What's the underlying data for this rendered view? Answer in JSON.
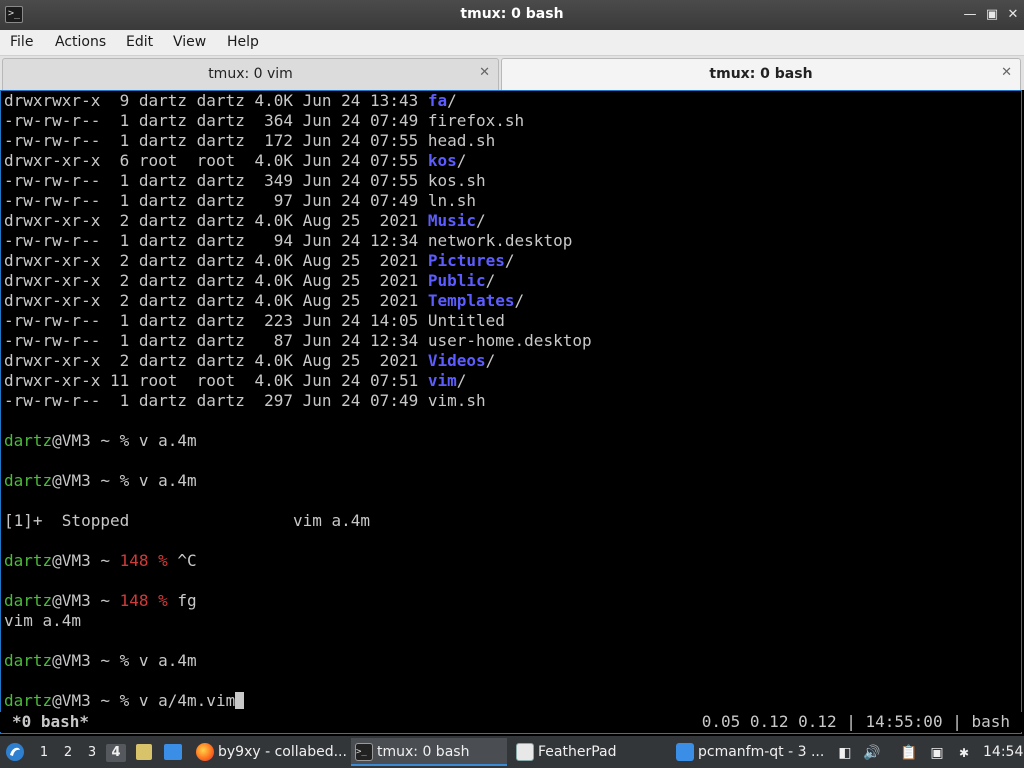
{
  "window": {
    "title": "tmux: 0 bash",
    "icon": "terminal-icon"
  },
  "menu": [
    "File",
    "Actions",
    "Edit",
    "View",
    "Help"
  ],
  "tabs": [
    {
      "label": "tmux: 0 vim"
    },
    {
      "label": "tmux: 0 bash"
    }
  ],
  "listing": [
    {
      "perms": "drwxrwxr-x",
      "links": " 9",
      "owner": "dartz",
      "group": "dartz",
      "size": "4.0K",
      "date": "Jun 24 13:43",
      "name": "fa",
      "dir": true
    },
    {
      "perms": "-rw-rw-r--",
      "links": " 1",
      "owner": "dartz",
      "group": "dartz",
      "size": " 364",
      "date": "Jun 24 07:49",
      "name": "firefox.sh",
      "dir": false
    },
    {
      "perms": "-rw-rw-r--",
      "links": " 1",
      "owner": "dartz",
      "group": "dartz",
      "size": " 172",
      "date": "Jun 24 07:55",
      "name": "head.sh",
      "dir": false
    },
    {
      "perms": "drwxr-xr-x",
      "links": " 6",
      "owner": "root ",
      "group": "root ",
      "size": "4.0K",
      "date": "Jun 24 07:55",
      "name": "kos",
      "dir": true
    },
    {
      "perms": "-rw-rw-r--",
      "links": " 1",
      "owner": "dartz",
      "group": "dartz",
      "size": " 349",
      "date": "Jun 24 07:55",
      "name": "kos.sh",
      "dir": false
    },
    {
      "perms": "-rw-rw-r--",
      "links": " 1",
      "owner": "dartz",
      "group": "dartz",
      "size": "  97",
      "date": "Jun 24 07:49",
      "name": "ln.sh",
      "dir": false
    },
    {
      "perms": "drwxr-xr-x",
      "links": " 2",
      "owner": "dartz",
      "group": "dartz",
      "size": "4.0K",
      "date": "Aug 25  2021",
      "name": "Music",
      "dir": true
    },
    {
      "perms": "-rw-rw-r--",
      "links": " 1",
      "owner": "dartz",
      "group": "dartz",
      "size": "  94",
      "date": "Jun 24 12:34",
      "name": "network.desktop",
      "dir": false
    },
    {
      "perms": "drwxr-xr-x",
      "links": " 2",
      "owner": "dartz",
      "group": "dartz",
      "size": "4.0K",
      "date": "Aug 25  2021",
      "name": "Pictures",
      "dir": true
    },
    {
      "perms": "drwxr-xr-x",
      "links": " 2",
      "owner": "dartz",
      "group": "dartz",
      "size": "4.0K",
      "date": "Aug 25  2021",
      "name": "Public",
      "dir": true
    },
    {
      "perms": "drwxr-xr-x",
      "links": " 2",
      "owner": "dartz",
      "group": "dartz",
      "size": "4.0K",
      "date": "Aug 25  2021",
      "name": "Templates",
      "dir": true
    },
    {
      "perms": "-rw-rw-r--",
      "links": " 1",
      "owner": "dartz",
      "group": "dartz",
      "size": " 223",
      "date": "Jun 24 14:05",
      "name": "Untitled",
      "dir": false
    },
    {
      "perms": "-rw-rw-r--",
      "links": " 1",
      "owner": "dartz",
      "group": "dartz",
      "size": "  87",
      "date": "Jun 24 12:34",
      "name": "user-home.desktop",
      "dir": false
    },
    {
      "perms": "drwxr-xr-x",
      "links": " 2",
      "owner": "dartz",
      "group": "dartz",
      "size": "4.0K",
      "date": "Aug 25  2021",
      "name": "Videos",
      "dir": true
    },
    {
      "perms": "drwxr-xr-x",
      "links": "11",
      "owner": "root ",
      "group": "root ",
      "size": "4.0K",
      "date": "Jun 24 07:51",
      "name": "vim",
      "dir": true
    },
    {
      "perms": "-rw-rw-r--",
      "links": " 1",
      "owner": "dartz",
      "group": "dartz",
      "size": " 297",
      "date": "Jun 24 07:49",
      "name": "vim.sh",
      "dir": false
    }
  ],
  "prompt": {
    "user": "dartz",
    "host": "@VM3 ~ ",
    "sign": "% "
  },
  "session": {
    "cmd1": "v a.4m",
    "cmd2": "v a.4m",
    "job_stopped": "[1]+  Stopped                 vim a.4m",
    "exit_code": "148",
    "cmd3": "^C",
    "cmd4": "fg",
    "fg_output": "vim a.4m",
    "cmd5": "v a.4m",
    "cmd6": "v a/4m.vim"
  },
  "tmux": {
    "window": "*0 bash*",
    "status_right": "0.05 0.12 0.12 | 14:55:00 | bash"
  },
  "taskbar": {
    "desktops": [
      "1",
      "2",
      "3",
      "4"
    ],
    "active_desktop": "4",
    "tasks": [
      {
        "label": "by9xy - collabed...",
        "icon": "firefox-icon"
      },
      {
        "label": "tmux: 0 bash",
        "icon": "terminal-icon"
      },
      {
        "label": "FeatherPad",
        "icon": "featherpad-icon"
      },
      {
        "label": "pcmanfm-qt - 3 ...",
        "icon": "folder-icon"
      }
    ],
    "clock": "14:54"
  }
}
